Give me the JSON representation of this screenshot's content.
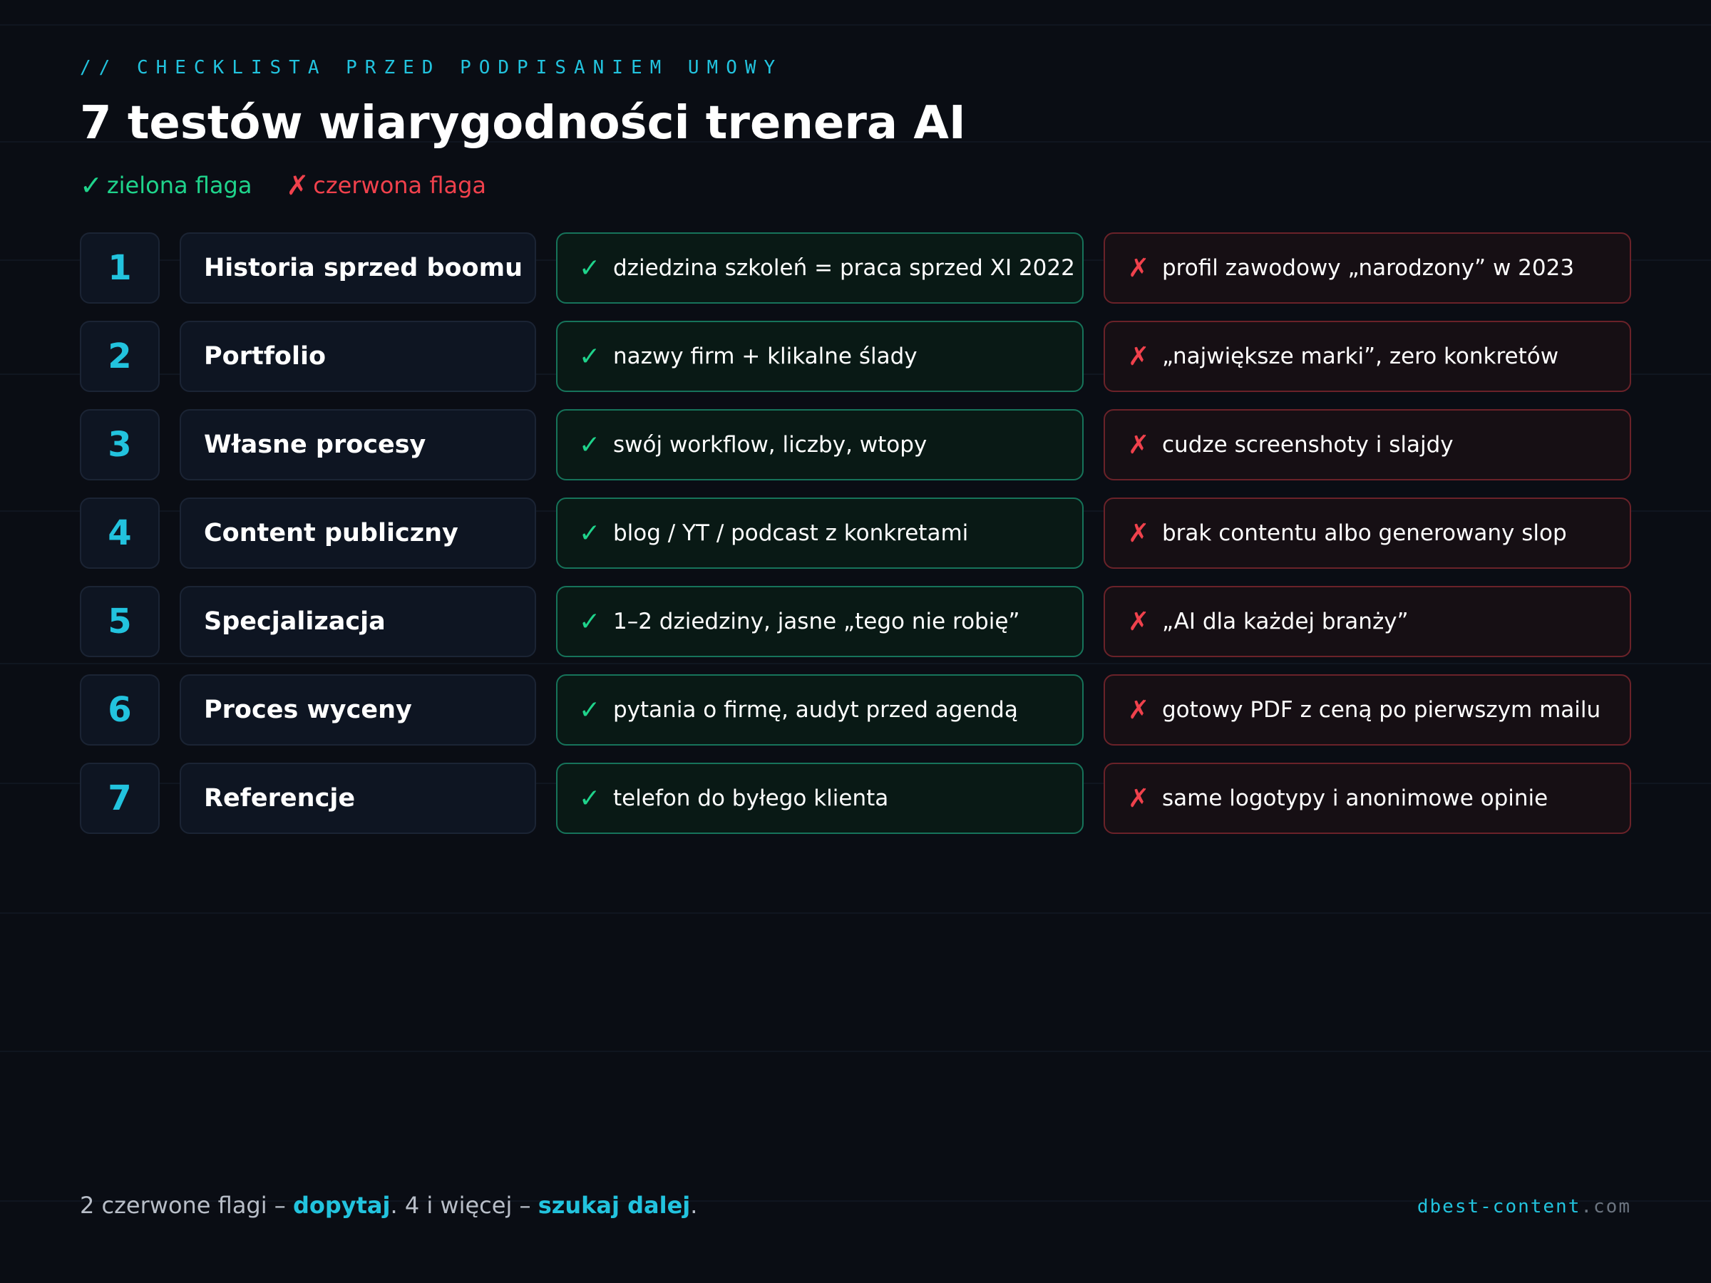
{
  "header": {
    "eyebrow": "// CHECKLISTA PRZED PODPISANIEM UMOWY",
    "title": "7 testów wiarygodności trenera AI"
  },
  "legend": {
    "green_mark": "✓",
    "green_label": "zielona flaga",
    "red_mark": "✗",
    "red_label": "czerwona flaga"
  },
  "colors": {
    "accent": "#22c3de",
    "green": "#1fd38b",
    "red": "#f0414c",
    "background": "#0a0d14"
  },
  "rows": [
    {
      "number": "1",
      "name": "Historia sprzed boomu",
      "green": "dziedzina szkoleń = praca sprzed XI 2022",
      "red": "profil zawodowy „narodzony” w 2023"
    },
    {
      "number": "2",
      "name": "Portfolio",
      "green": "nazwy firm + klikalne ślady",
      "red": "„największe marki”, zero konkretów"
    },
    {
      "number": "3",
      "name": "Własne procesy",
      "green": "swój workflow, liczby, wtopy",
      "red": "cudze screenshoty i slajdy"
    },
    {
      "number": "4",
      "name": "Content publiczny",
      "green": "blog / YT / podcast z konkretami",
      "red": "brak contentu albo generowany slop"
    },
    {
      "number": "5",
      "name": "Specjalizacja",
      "green": "1–2 dziedziny, jasne „tego nie robię”",
      "red": "„AI dla każdej branży”"
    },
    {
      "number": "6",
      "name": "Proces wyceny",
      "green": "pytania o firmę, audyt przed agendą",
      "red": "gotowy PDF z ceną po pierwszym mailu"
    },
    {
      "number": "7",
      "name": "Referencje",
      "green": "telefon do byłego klienta",
      "red": "same logotypy i anonimowe opinie"
    }
  ],
  "row_marks": {
    "green": "✓",
    "red": "✗"
  },
  "footer": {
    "part1": "2 czerwone flagi – ",
    "accent1": "dopytaj",
    "part2": ". 4 i więcej – ",
    "accent2": "szukaj dalej",
    "part3": ".",
    "brand_main": "dbest-content",
    "brand_tld": ".com"
  }
}
